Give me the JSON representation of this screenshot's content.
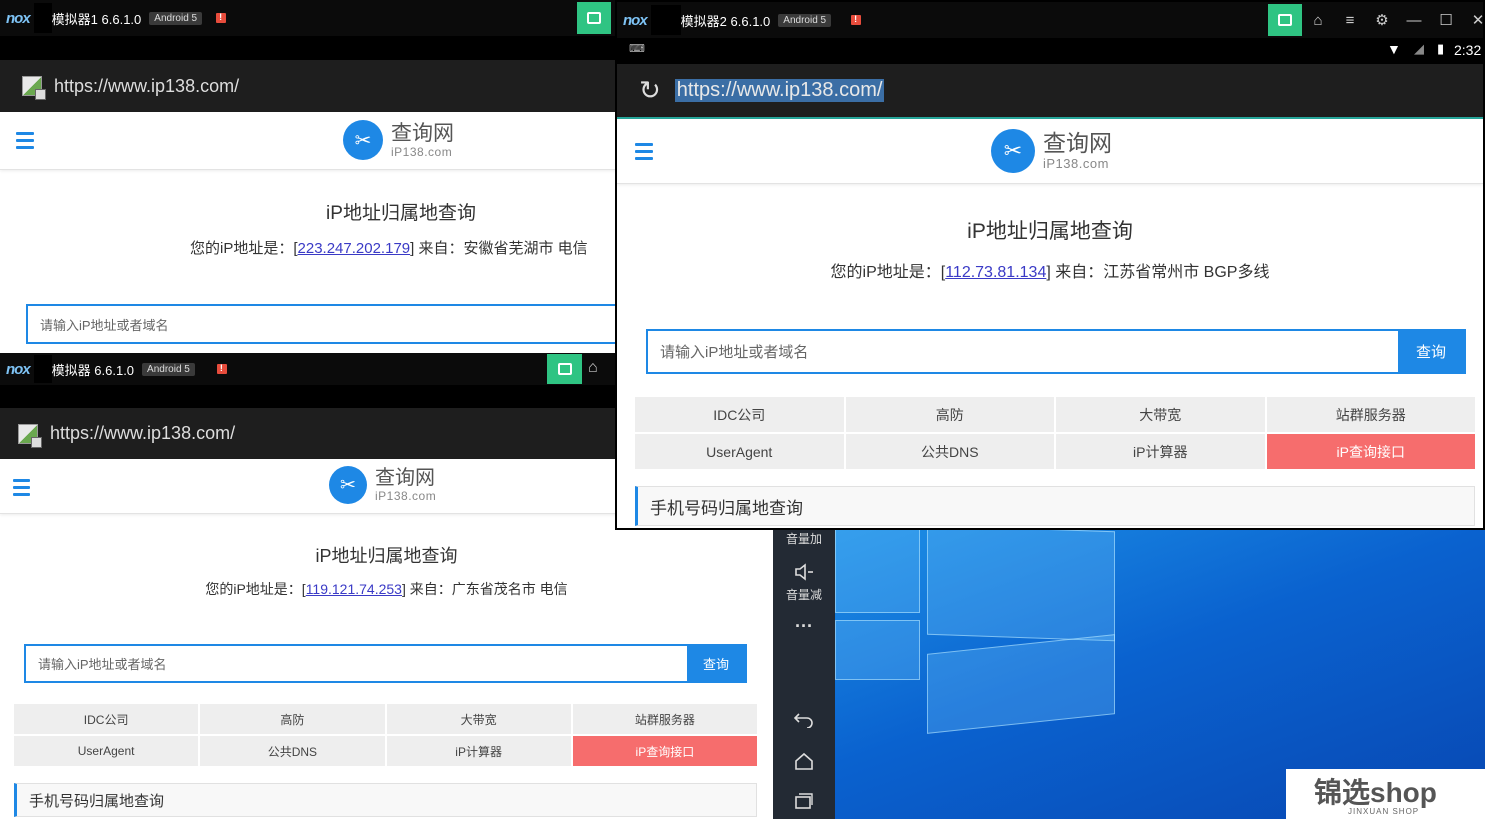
{
  "colors": {
    "accent": "#1e88e5",
    "hot": "#f66d6d",
    "nox_green": "#2fc483"
  },
  "windows": [
    {
      "title": "模拟器1 6.6.1.0",
      "android": "Android 5",
      "url": "https://www.ip138.com/",
      "logo_cn": "查询网",
      "logo_en": "iP138.com",
      "heading": "iP地址归属地查询",
      "ip_prefix": "您的iP地址是：[",
      "ip": "223.247.202.179",
      "ip_suffix": "] 来自：安徽省芜湖市 电信",
      "placeholder": "请输入iP地址或者域名"
    },
    {
      "title": "模拟器2 6.6.1.0",
      "android": "Android 5",
      "clock": "2:32",
      "url": "https://www.ip138.com/",
      "logo_cn": "查询网",
      "logo_en": "iP138.com",
      "heading": "iP地址归属地查询",
      "ip_prefix": "您的iP地址是：[",
      "ip": "112.73.81.134",
      "ip_suffix": "] 来自：江苏省常州市 BGP多线",
      "placeholder": "请输入iP地址或者域名",
      "search_label": "查询",
      "grid": [
        "IDC公司",
        "高防",
        "大带宽",
        "站群服务器",
        "UserAgent",
        "公共DNS",
        "iP计算器",
        "iP查询接口"
      ],
      "section": "手机号码归属地查询"
    },
    {
      "title": "模拟器 6.6.1.0",
      "android": "Android 5",
      "url": "https://www.ip138.com/",
      "logo_cn": "查询网",
      "logo_en": "iP138.com",
      "heading": "iP地址归属地查询",
      "ip_prefix": "您的iP地址是：[",
      "ip": "119.121.74.253",
      "ip_suffix": "] 来自：广东省茂名市 电信",
      "placeholder": "请输入iP地址或者域名",
      "search_label": "查询",
      "grid": [
        "IDC公司",
        "高防",
        "大带宽",
        "站群服务器",
        "UserAgent",
        "公共DNS",
        "iP计算器",
        "iP查询接口"
      ],
      "section": "手机号码归属地查询"
    }
  ],
  "sidebar": {
    "vol_up": "音量加",
    "vol_down": "音量减",
    "more": "···"
  },
  "nox_logo": "nox",
  "watermark": {
    "brand": "锦选shop",
    "sub": "JINXUAN SHOP"
  }
}
